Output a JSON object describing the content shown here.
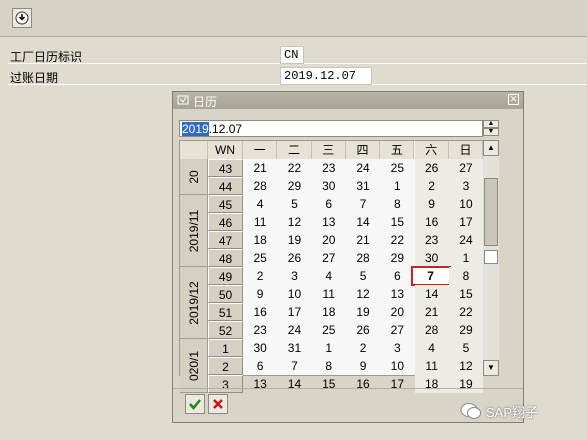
{
  "toolbar": {
    "icon": "execute-icon"
  },
  "fields": [
    {
      "label": "工厂日历标识",
      "value": "CN"
    },
    {
      "label": "过账日期",
      "value": "2019.12.07"
    }
  ],
  "dialog": {
    "title": "日历",
    "input": {
      "selected": "2019",
      "rest": ".12.07"
    },
    "col_wn": "WN",
    "weekdays": [
      "一",
      "二",
      "三",
      "四",
      "五",
      "六",
      "日"
    ],
    "months": [
      {
        "label": "20",
        "rows": 2
      },
      {
        "label": "2019/11",
        "rows": 4
      },
      {
        "label": "2019/12",
        "rows": 4
      },
      {
        "label": "020/1",
        "rows": 3
      }
    ],
    "weeks": [
      {
        "wn": "43",
        "days": [
          "21",
          "22",
          "23",
          "24",
          "25",
          "26",
          "27"
        ]
      },
      {
        "wn": "44",
        "days": [
          "28",
          "29",
          "30",
          "31",
          "1",
          "2",
          "3"
        ]
      },
      {
        "wn": "45",
        "days": [
          "4",
          "5",
          "6",
          "7",
          "8",
          "9",
          "10"
        ]
      },
      {
        "wn": "46",
        "days": [
          "11",
          "12",
          "13",
          "14",
          "15",
          "16",
          "17"
        ]
      },
      {
        "wn": "47",
        "days": [
          "18",
          "19",
          "20",
          "21",
          "22",
          "23",
          "24"
        ]
      },
      {
        "wn": "48",
        "days": [
          "25",
          "26",
          "27",
          "28",
          "29",
          "30",
          "1"
        ]
      },
      {
        "wn": "49",
        "days": [
          "2",
          "3",
          "4",
          "5",
          "6",
          "7",
          "8"
        ]
      },
      {
        "wn": "50",
        "days": [
          "9",
          "10",
          "11",
          "12",
          "13",
          "14",
          "15"
        ]
      },
      {
        "wn": "51",
        "days": [
          "16",
          "17",
          "18",
          "19",
          "20",
          "21",
          "22"
        ]
      },
      {
        "wn": "52",
        "days": [
          "23",
          "24",
          "25",
          "26",
          "27",
          "28",
          "29"
        ]
      },
      {
        "wn": "1",
        "days": [
          "30",
          "31",
          "1",
          "2",
          "3",
          "4",
          "5"
        ]
      },
      {
        "wn": "2",
        "days": [
          "6",
          "7",
          "8",
          "9",
          "10",
          "11",
          "12"
        ]
      },
      {
        "wn": "3",
        "days": [
          "13",
          "14",
          "15",
          "16",
          "17",
          "18",
          "19"
        ]
      }
    ],
    "selected_day": "7",
    "ok_icon": "check-icon",
    "cancel_icon": "cancel-icon"
  },
  "watermark": "SAP翔子"
}
